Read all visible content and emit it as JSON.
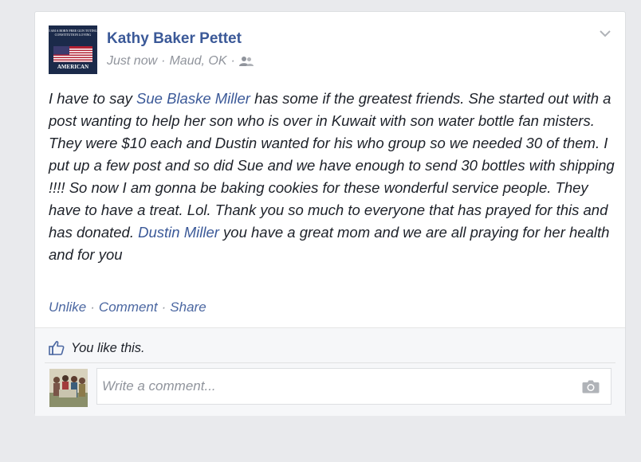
{
  "post": {
    "author": "Kathy Baker Pettet",
    "avatar_text_top": "I AM A BORN FREE GUN TOTING CONSTITUTION LOVING",
    "avatar_text_bottom": "AMERICAN",
    "time": "Just now",
    "separator": "·",
    "location": "Maud, OK",
    "privacy_icon": "friends-icon",
    "message": {
      "part1": "I have to say ",
      "tag1": "Sue Blaske Miller",
      "part2": " has some if the greatest friends. She started out with a post wanting to help her son who is over in Kuwait with son water bottle fan misters. They were $10 each and Dustin wanted for his who group so we needed 30 of them. I put up a few post and so did Sue and we have enough to send 30 bottles with shipping !!!! So now I am gonna be baking cookies for these wonderful service people. They have to have a treat. Lol. Thank you so much to everyone that has prayed for this and has donated. ",
      "tag2": "Dustin Miller",
      "part3": " you have a great mom and we are all praying for her health and for you"
    },
    "actions": {
      "unlike": "Unlike",
      "comment": "Comment",
      "share": "Share",
      "separator": "·"
    }
  },
  "likes": {
    "icon": "thumbs-up-icon",
    "text": "You like this."
  },
  "comment_box": {
    "placeholder": "Write a comment...",
    "icon": "camera-icon"
  },
  "colors": {
    "link": "#3b5998",
    "meta": "#90949c",
    "text": "#1d2129",
    "background": "#e9eaed"
  }
}
